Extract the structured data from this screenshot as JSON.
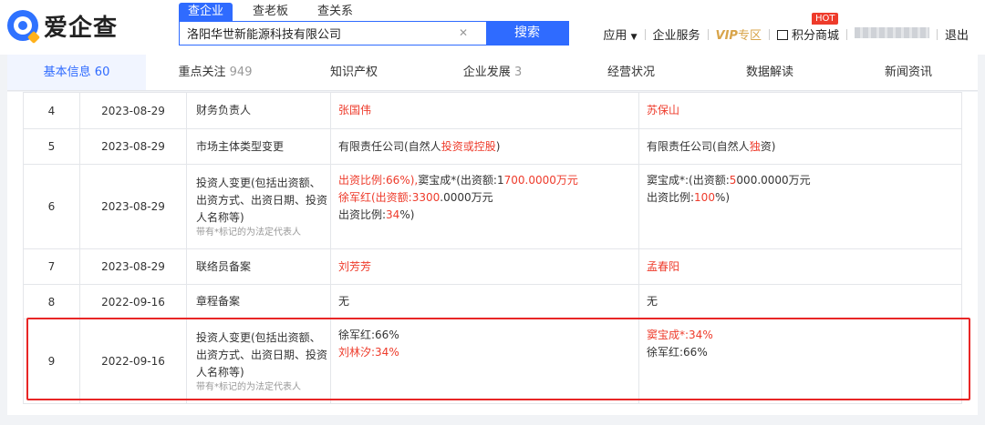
{
  "header": {
    "logo_text": "爱企查",
    "search_tabs": [
      "查企业",
      "查老板",
      "查关系"
    ],
    "search_value": "洛阳华世新能源科技有限公司",
    "search_button": "搜索",
    "nav": {
      "apps": "应用",
      "enterprise_service": "企业服务",
      "vip": "VIP",
      "vip_zone": "专区",
      "points_mall": "积分商城",
      "hot_badge": "HOT",
      "logout": "退出"
    }
  },
  "tabs": [
    {
      "label": "基本信息",
      "count": "60"
    },
    {
      "label": "重点关注",
      "count": "949"
    },
    {
      "label": "知识产权",
      "count": ""
    },
    {
      "label": "企业发展",
      "count": "3"
    },
    {
      "label": "经营状况",
      "count": ""
    },
    {
      "label": "数据解读",
      "count": ""
    },
    {
      "label": "新闻资讯",
      "count": ""
    }
  ],
  "rows": [
    {
      "no": "4",
      "date": "2023-08-29",
      "item": "财务负责人",
      "before": "张国伟",
      "after": "苏保山"
    },
    {
      "no": "5",
      "date": "2023-08-29",
      "item": "市场主体类型变更",
      "before_a": "有限责任公司(自然人",
      "before_b": "投资",
      "before_c": "或",
      "before_d": "控股",
      "before_e": ")",
      "after_a": "有限责任公司(自然人",
      "after_b": "独",
      "after_c": "资)"
    },
    {
      "no": "6",
      "date": "2023-08-29",
      "item": "投资人变更(包括出资额、出资方式、出资日期、投资人名称等)",
      "note": "带有*标记的为法定代表人",
      "before_l1": "出资比例:66%),",
      "before_l1b": "窦宝成*(出资额:1",
      "before_l1c": "700.0000万元",
      "before_l2": "徐军红(出资额:3300",
      "before_l2b": ".0000万元",
      "before_l3": "出资比例:",
      "before_l3b": "34",
      "before_l3c": "%)",
      "after_l1": "窦宝成*:(出资额:",
      "after_l1b": "5",
      "after_l1c": "000.0000万元",
      "after_l2": "出资比例:",
      "after_l2b": "100",
      "after_l2c": "%)"
    },
    {
      "no": "7",
      "date": "2023-08-29",
      "item": "联络员备案",
      "before": "刘芳芳",
      "after": "孟春阳"
    },
    {
      "no": "8",
      "date": "2022-09-16",
      "item": "章程备案",
      "before": "无",
      "after": "无"
    },
    {
      "no": "9",
      "date": "2022-09-16",
      "item": "投资人变更(包括出资额、出资方式、出资日期、投资人名称等)",
      "note": "带有*标记的为法定代表人",
      "before_l1": "徐军红:66%",
      "before_l2": "刘林汐:34%",
      "after_l1": "窦宝成*:34%",
      "after_l2": "徐军红:66%"
    }
  ]
}
